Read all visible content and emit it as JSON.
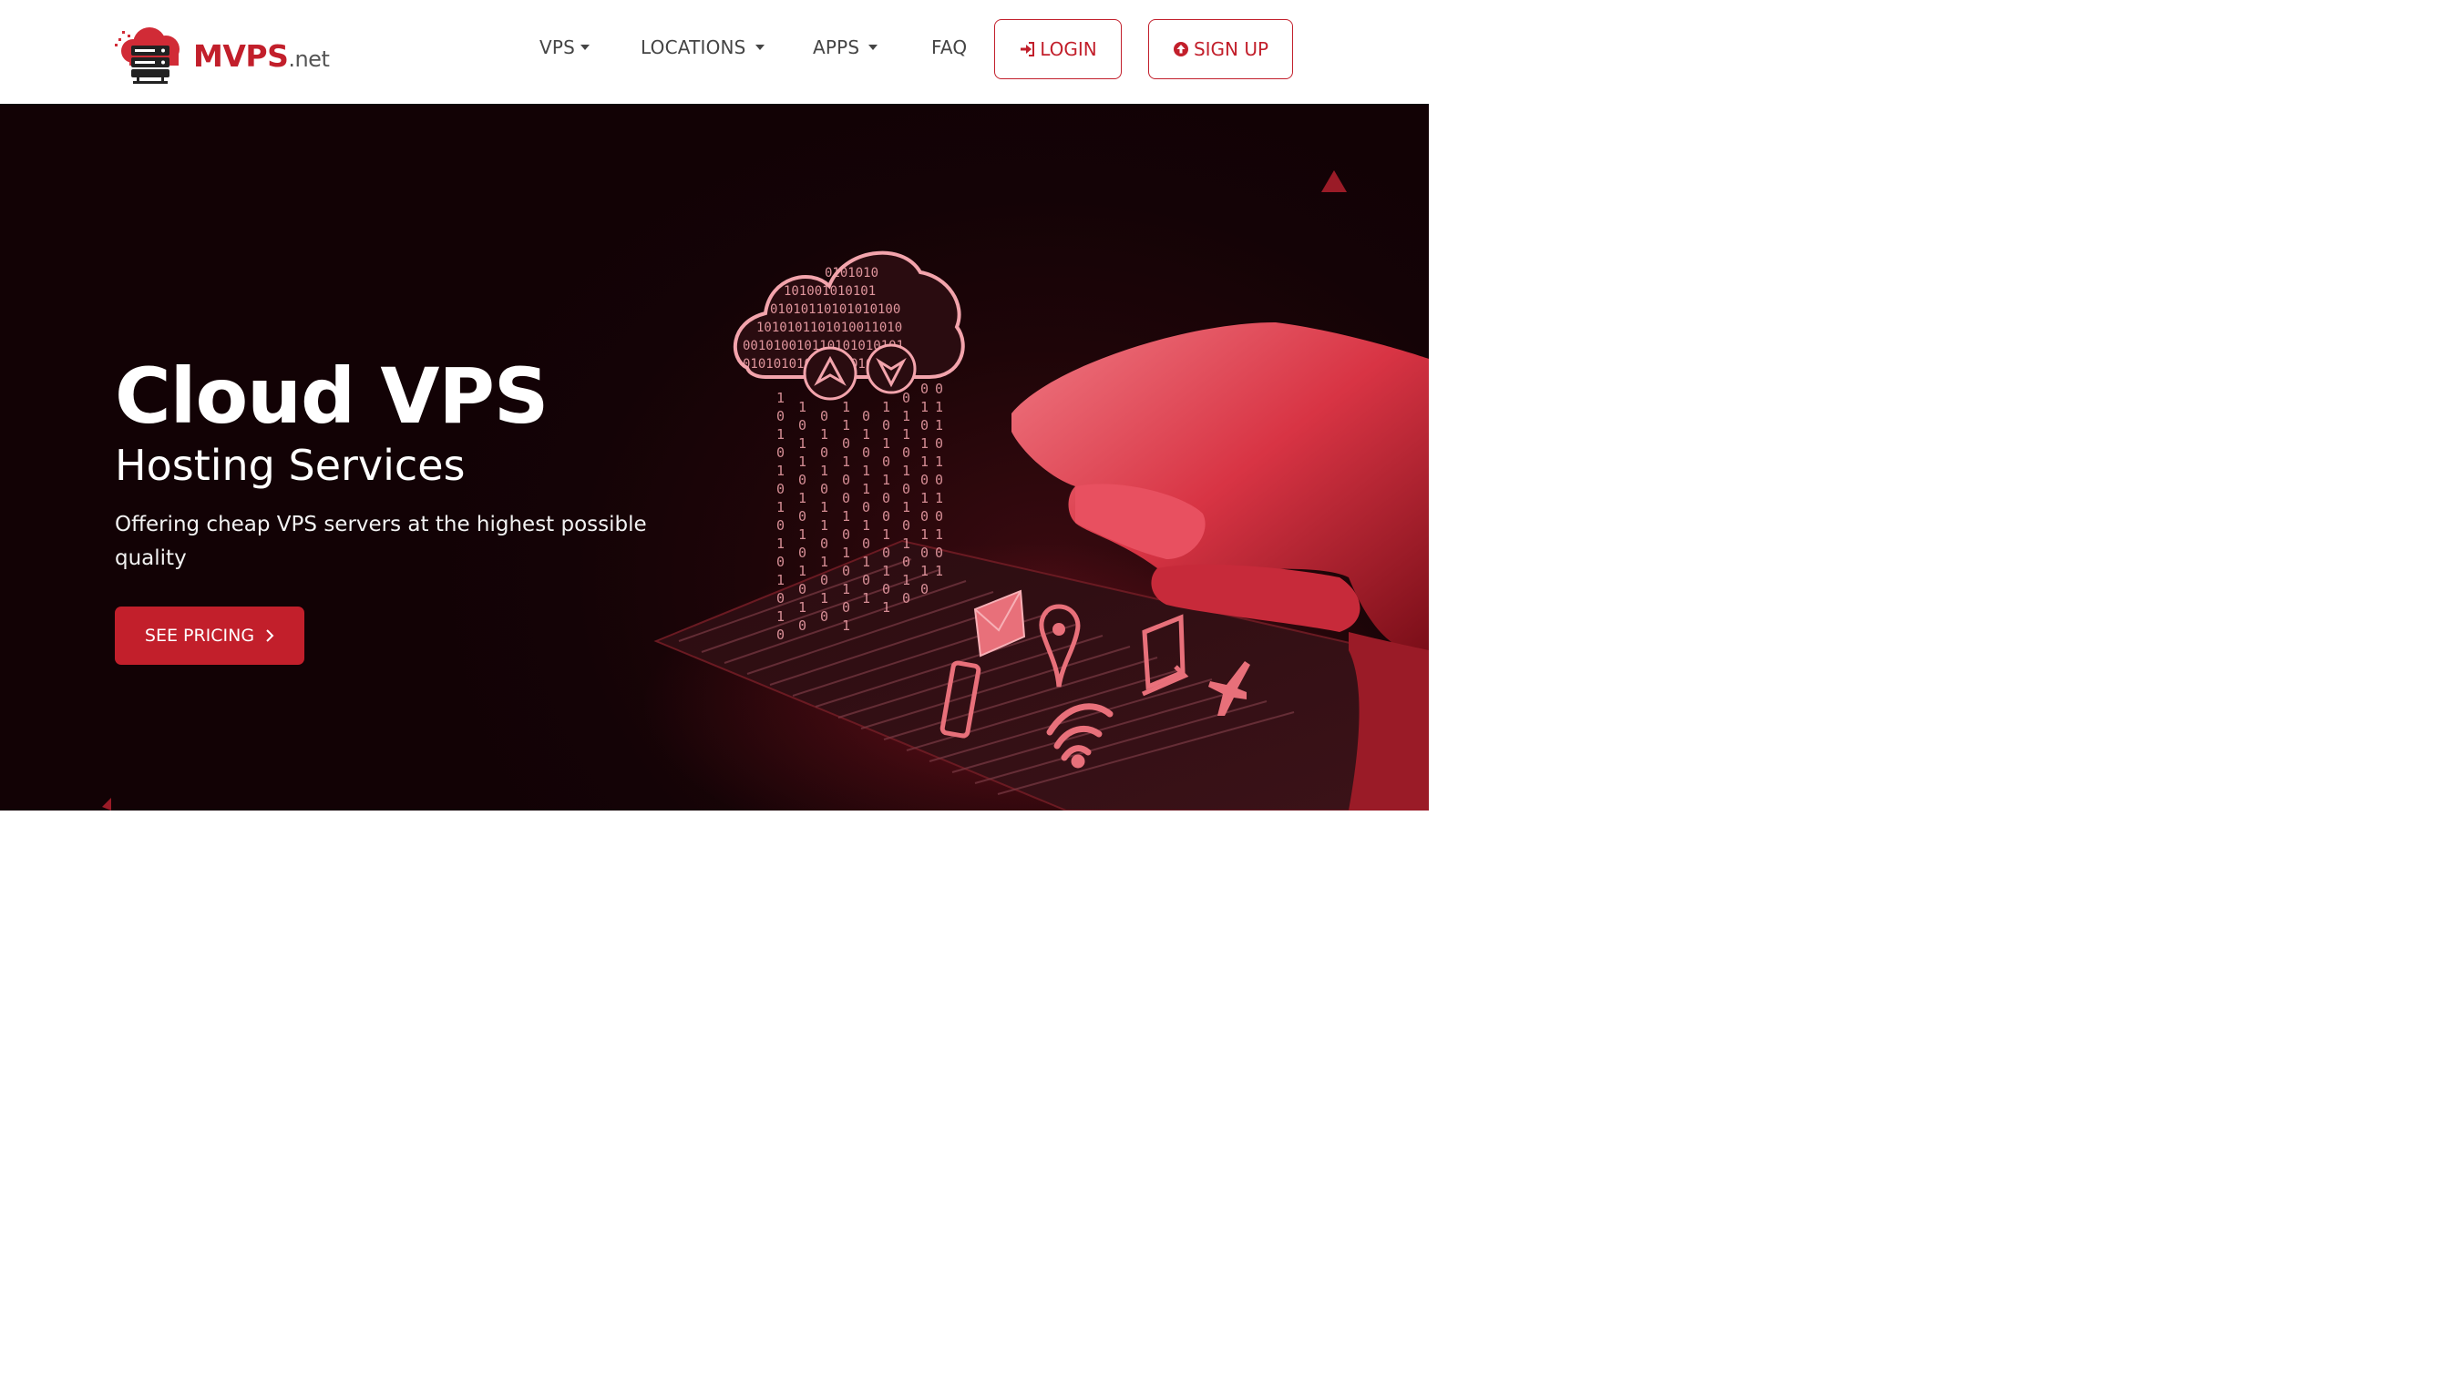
{
  "brand": {
    "name": "MVPS",
    "tld": ".net"
  },
  "nav": {
    "vps": "VPS",
    "locations": "LOCATIONS",
    "apps": "APPS",
    "faq": "FAQ",
    "login": "LOGIN",
    "signup": "SIGN UP"
  },
  "hero": {
    "title": "Cloud VPS",
    "subtitle": "Hosting Services",
    "description": "Offering cheap VPS servers at the highest possible quality",
    "cta": "SEE PRICING"
  },
  "colors": {
    "accent": "#c21f2b",
    "background_dark": "#140306"
  },
  "icons": [
    "cloud-server-logo-icon",
    "caret-down-icon",
    "login-icon",
    "arrow-up-circle-icon",
    "chevron-right-icon",
    "cloud-icon",
    "upload-arrow-icon",
    "download-arrow-icon",
    "envelope-icon",
    "map-pin-icon",
    "phone-icon",
    "wifi-icon",
    "laptop-icon",
    "airplane-icon"
  ]
}
